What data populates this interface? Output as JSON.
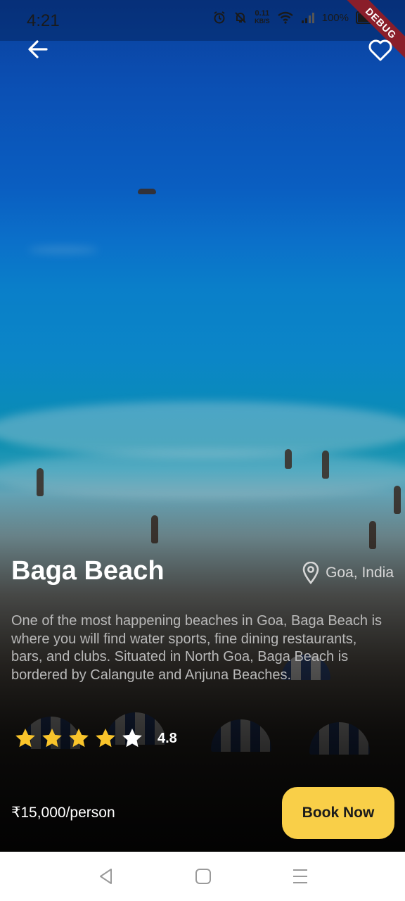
{
  "status_bar": {
    "time": "4:21",
    "net_speed_value": "0.11",
    "net_speed_unit": "KB/S",
    "battery": "100%",
    "debug_label": "DEBUG"
  },
  "destination": {
    "name": "Baga Beach",
    "location": "Goa, India",
    "description": "One of the most happening beaches in Goa, Baga Beach is where you will find water sports, fine dining restaurants, bars, and clubs. Situated in North Goa, Baga Beach is bordered by Calangute and Anjuna Beaches.",
    "rating_value": "4.8",
    "stars_filled": 4,
    "stars_total": 5,
    "price": "₹15,000/person"
  },
  "actions": {
    "book_label": "Book Now"
  },
  "colors": {
    "accent": "#f9cf48",
    "star": "#f9c42b"
  },
  "icons": {
    "back": "arrow-left-icon",
    "favorite": "heart-outline-icon",
    "location": "map-pin-icon",
    "star": "star-icon"
  }
}
